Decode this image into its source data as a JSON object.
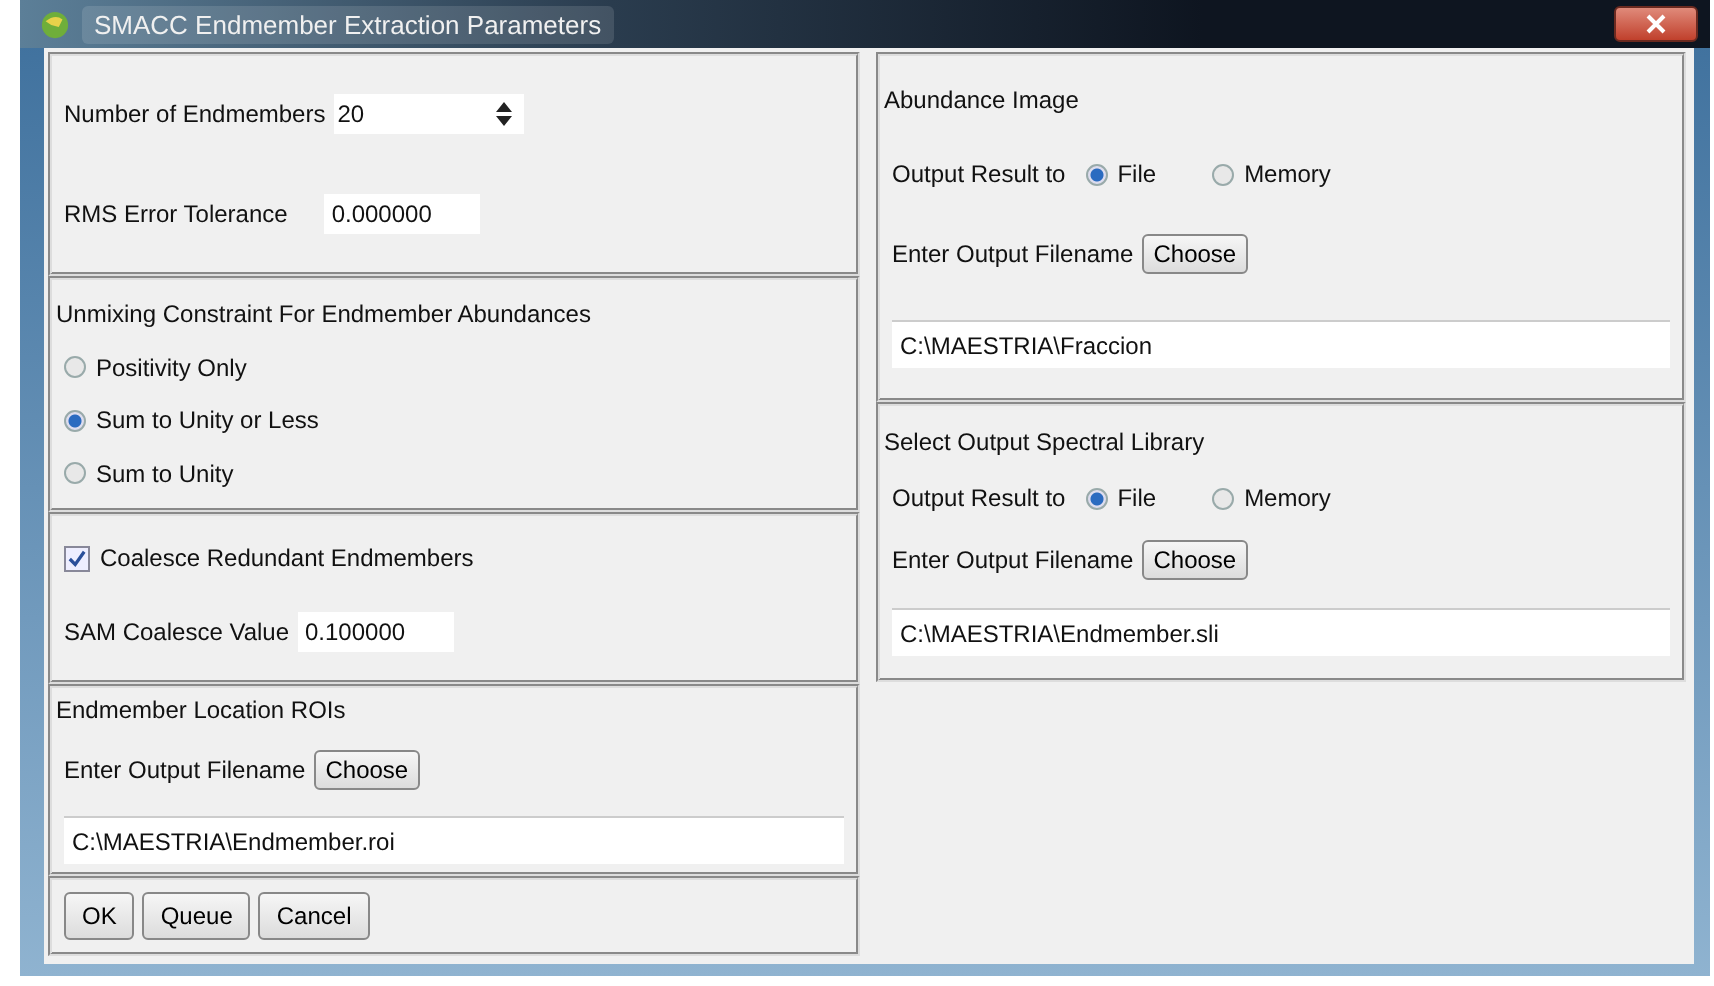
{
  "window": {
    "title": "SMACC Endmember Extraction Parameters"
  },
  "parameters": {
    "endmembers": {
      "label": "Number of Endmembers",
      "value": "20"
    },
    "rms": {
      "label": "RMS Error Tolerance",
      "value": "0.000000"
    }
  },
  "unmixing": {
    "title": "Unmixing Constraint For Endmember Abundances",
    "options": [
      {
        "label": "Positivity Only",
        "selected": false
      },
      {
        "label": "Sum to Unity or Less",
        "selected": true
      },
      {
        "label": "Sum to Unity",
        "selected": false
      }
    ]
  },
  "coalesce": {
    "label": "Coalesce Redundant Endmembers",
    "checked": true,
    "value_label": "SAM Coalesce Value",
    "value": "0.100000"
  },
  "roi_output": {
    "title": "Endmember Location ROIs",
    "filename_label": "Enter Output Filename",
    "choose": "Choose",
    "filename": "C:\\MAESTRIA\\Endmember.roi"
  },
  "buttons": [
    "OK",
    "Queue",
    "Cancel"
  ],
  "abundance": {
    "title": "Abundance Image",
    "output_label": "Output Result to",
    "options": [
      {
        "label": "File",
        "selected": true
      },
      {
        "label": "Memory",
        "selected": false
      }
    ],
    "filename_label": "Enter Output Filename",
    "choose": "Choose",
    "filename": "C:\\MAESTRIA\\Fraccion"
  },
  "spectral_library": {
    "title": "Select Output Spectral Library",
    "output_label": "Output Result to",
    "options": [
      {
        "label": "File",
        "selected": true
      },
      {
        "label": "Memory",
        "selected": false
      }
    ],
    "filename_label": "Enter Output Filename",
    "choose": "Choose",
    "filename": "C:\\MAESTRIA\\Endmember.sli"
  }
}
